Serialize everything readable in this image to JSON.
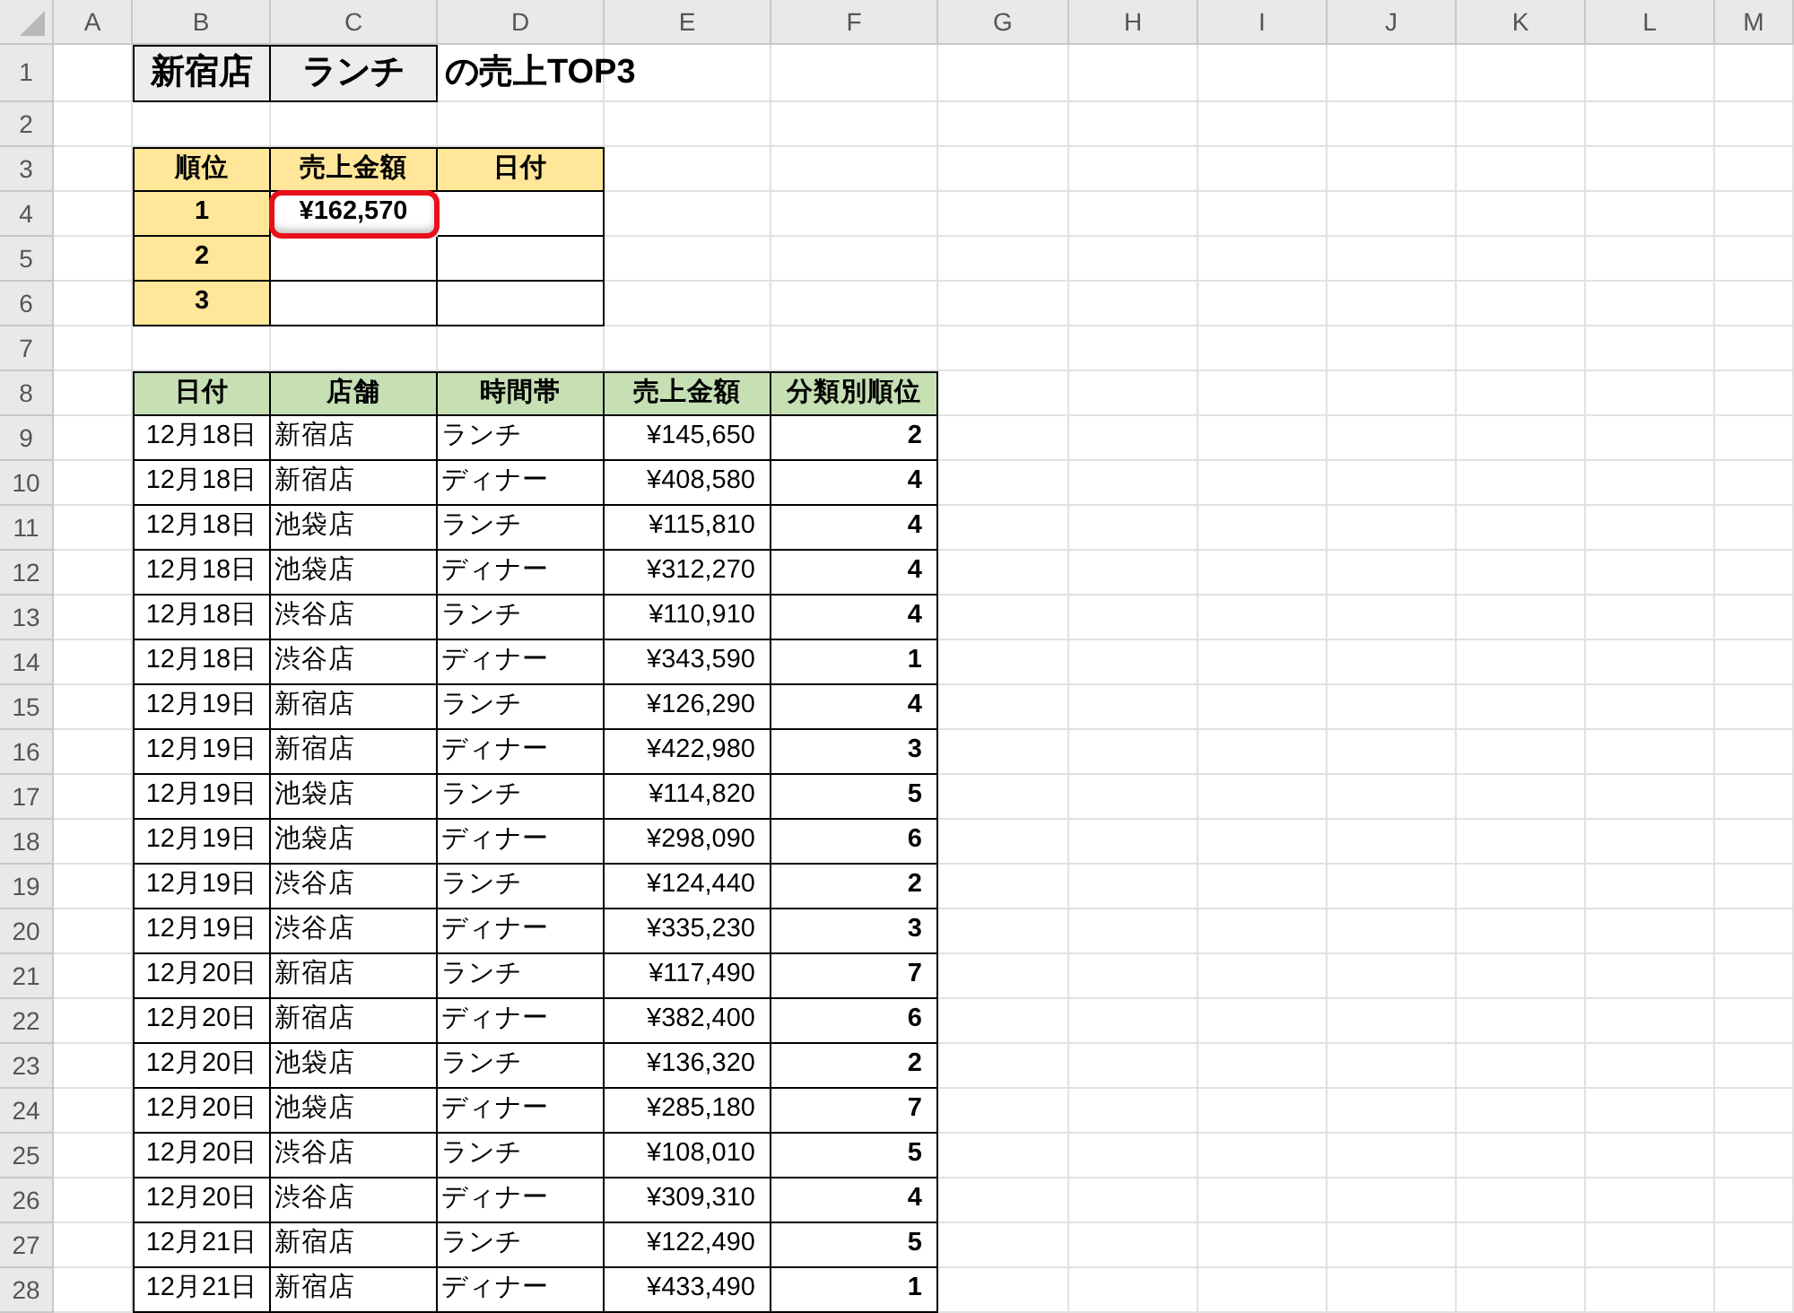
{
  "column_headers": [
    "A",
    "B",
    "C",
    "D",
    "E",
    "F",
    "G",
    "H",
    "I",
    "J",
    "K",
    "L",
    "M"
  ],
  "row_numbers": [
    "1",
    "2",
    "3",
    "4",
    "5",
    "6",
    "7",
    "8",
    "9",
    "10",
    "11",
    "12",
    "13",
    "14",
    "15",
    "16",
    "17",
    "18",
    "19",
    "20",
    "21",
    "22",
    "23",
    "24",
    "25",
    "26",
    "27",
    "28"
  ],
  "title": {
    "store": "新宿店",
    "period": "ランチ",
    "suffix": "の売上TOP3"
  },
  "top3": {
    "columns": [
      "順位",
      "売上金額",
      "日付"
    ],
    "rows": [
      {
        "rank": "1",
        "amount": "¥162,570",
        "highlighted": true
      },
      {
        "rank": "2",
        "highlighted": false
      },
      {
        "rank": "3",
        "highlighted": false
      }
    ]
  },
  "sales": {
    "columns": [
      "日付",
      "店舗",
      "時間帯",
      "売上金額",
      "分類別順位"
    ],
    "rows": [
      [
        "12月18日",
        "新宿店",
        "ランチ",
        "¥145,650",
        "2"
      ],
      [
        "12月18日",
        "新宿店",
        "ディナー",
        "¥408,580",
        "4"
      ],
      [
        "12月18日",
        "池袋店",
        "ランチ",
        "¥115,810",
        "4"
      ],
      [
        "12月18日",
        "池袋店",
        "ディナー",
        "¥312,270",
        "4"
      ],
      [
        "12月18日",
        "渋谷店",
        "ランチ",
        "¥110,910",
        "4"
      ],
      [
        "12月18日",
        "渋谷店",
        "ディナー",
        "¥343,590",
        "1"
      ],
      [
        "12月19日",
        "新宿店",
        "ランチ",
        "¥126,290",
        "4"
      ],
      [
        "12月19日",
        "新宿店",
        "ディナー",
        "¥422,980",
        "3"
      ],
      [
        "12月19日",
        "池袋店",
        "ランチ",
        "¥114,820",
        "5"
      ],
      [
        "12月19日",
        "池袋店",
        "ディナー",
        "¥298,090",
        "6"
      ],
      [
        "12月19日",
        "渋谷店",
        "ランチ",
        "¥124,440",
        "2"
      ],
      [
        "12月19日",
        "渋谷店",
        "ディナー",
        "¥335,230",
        "3"
      ],
      [
        "12月20日",
        "新宿店",
        "ランチ",
        "¥117,490",
        "7"
      ],
      [
        "12月20日",
        "新宿店",
        "ディナー",
        "¥382,400",
        "6"
      ],
      [
        "12月20日",
        "池袋店",
        "ランチ",
        "¥136,320",
        "2"
      ],
      [
        "12月20日",
        "池袋店",
        "ディナー",
        "¥285,180",
        "7"
      ],
      [
        "12月20日",
        "渋谷店",
        "ランチ",
        "¥108,010",
        "5"
      ],
      [
        "12月20日",
        "渋谷店",
        "ディナー",
        "¥309,310",
        "4"
      ],
      [
        "12月21日",
        "新宿店",
        "ランチ",
        "¥122,490",
        "5"
      ],
      [
        "12月21日",
        "新宿店",
        "ディナー",
        "¥433,490",
        "1"
      ]
    ]
  }
}
